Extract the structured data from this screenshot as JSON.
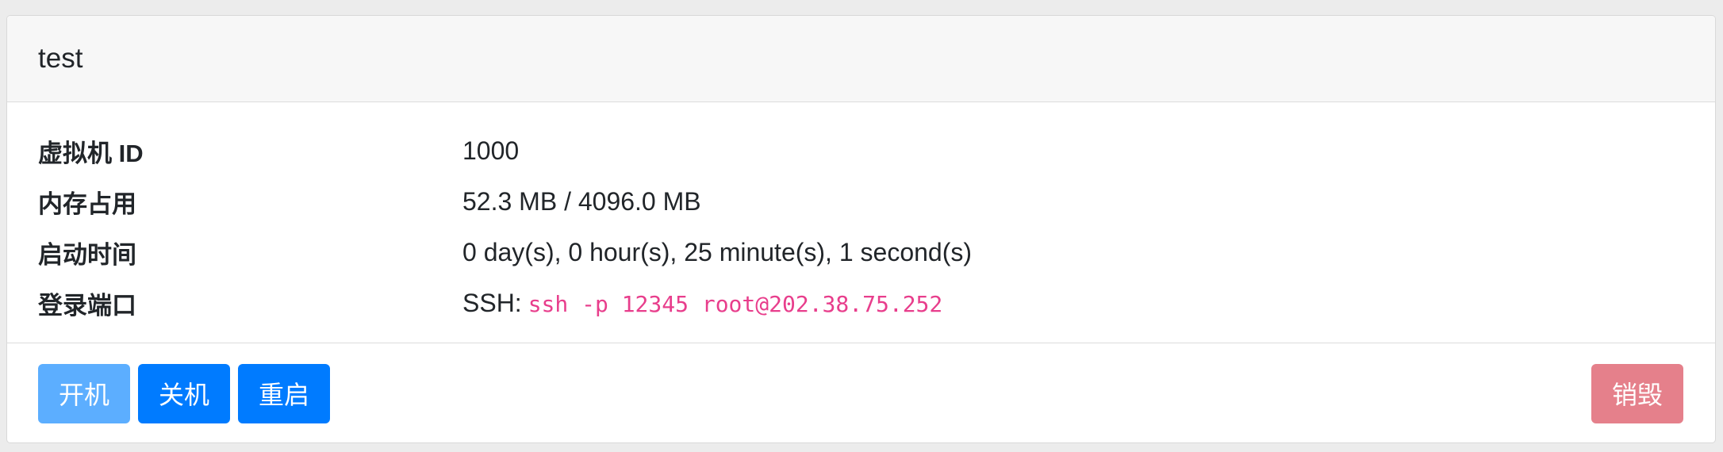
{
  "card": {
    "title": "test"
  },
  "details": [
    {
      "label": "虚拟机 ID",
      "value": "1000"
    },
    {
      "label": "内存占用",
      "value": "52.3 MB / 4096.0 MB"
    },
    {
      "label": "启动时间",
      "value": "0 day(s), 0 hour(s), 25 minute(s), 1 second(s)"
    },
    {
      "label": "登录端口",
      "prefix": "SSH:",
      "code": "ssh -p 12345 root@202.38.75.252"
    }
  ],
  "actions": {
    "start_label": "开机",
    "shutdown_label": "关机",
    "reboot_label": "重启",
    "destroy_label": "销毁"
  },
  "colors": {
    "primary": "#007bff",
    "primary_disabled": "#5caeff",
    "danger_disabled": "#e5808b",
    "code": "#e83e8c"
  }
}
